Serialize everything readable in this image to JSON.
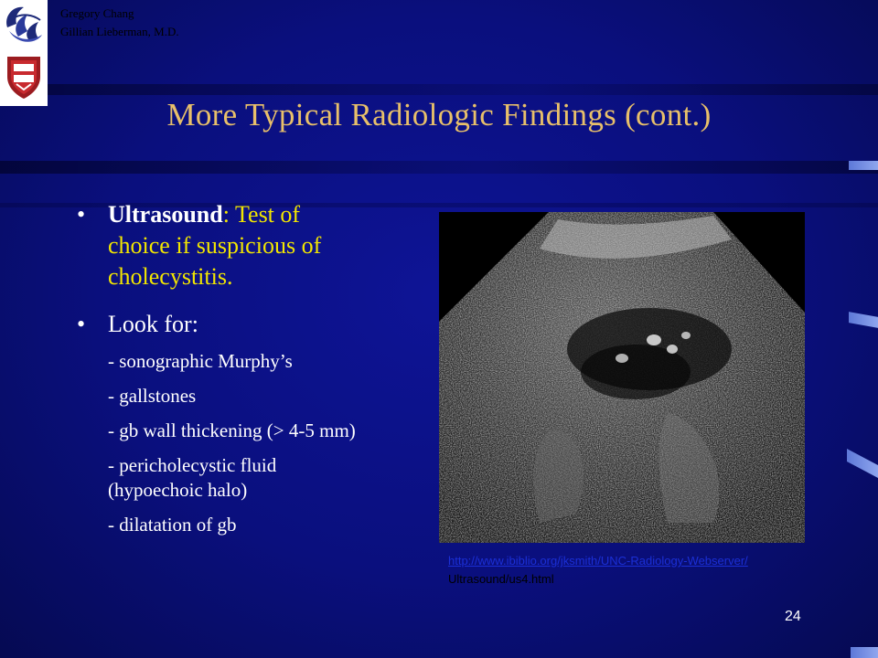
{
  "slide": {
    "authors": [
      "Gregory Chang",
      "Gillian Lieberman, M.D."
    ],
    "title": "More Typical Radiologic Findings (cont.)",
    "bullet1": {
      "bullet_char": "•",
      "keyword": "Ultrasound",
      "rest_line1": ": Test of",
      "line2": "choice if suspicious of",
      "line3": "cholecystitis."
    },
    "bullet2": {
      "bullet_char": "•",
      "text": "Look for:",
      "items": [
        "- sonographic Murphy’s",
        "- gallstones",
        "- gb wall thickening (> 4-5 mm)",
        "- pericholecystic fluid",
        "(hypoechoic halo)",
        "- dilatation of gb"
      ]
    },
    "image_caption": {
      "link": "http://www.ibiblio.org/jksmith/UNC-Radiology-Webserver/",
      "text": "Ultrasound/us4.html"
    },
    "page_number": "24"
  },
  "colors": {
    "background": "#0b0f78",
    "title": "#e8c06a",
    "highlight_text": "#f2e600",
    "body_text": "#ffffff",
    "link": "#1b2fd6"
  },
  "icons": {
    "logo_top": "swirl-figures-logo-icon",
    "logo_bottom": "harvard-shield-logo-icon"
  }
}
